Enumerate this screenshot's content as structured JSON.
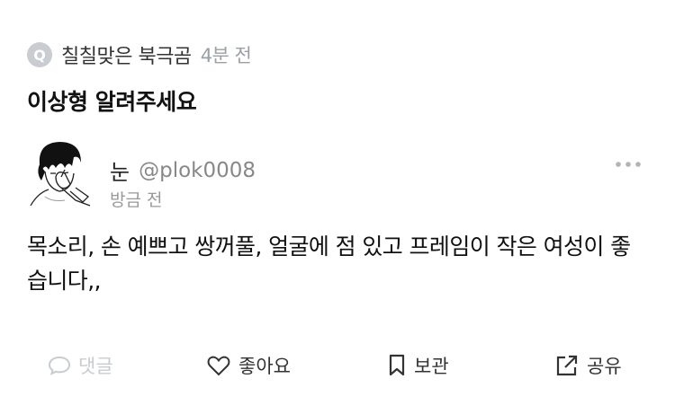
{
  "question": {
    "badge": "Q",
    "author": "칠칠맞은 북극곰",
    "time": "4분 전",
    "title": "이상형 알려주세요"
  },
  "answer": {
    "author_name": "눈",
    "author_handle": "@plok0008",
    "time": "방금 전",
    "text": "목소리, 손 예쁘고 쌍꺼풀, 얼굴에 점 있고 프레임이 작은 여성이 좋습니다,,"
  },
  "actions": {
    "comment": "댓글",
    "like": "좋아요",
    "save": "보관",
    "share": "공유"
  },
  "icons": {
    "question_badge": "q-badge-icon",
    "more": "more-dots-icon",
    "comment": "speech-bubble-icon",
    "like": "heart-icon",
    "save": "bookmark-icon",
    "share": "share-arrow-icon"
  },
  "colors": {
    "badge_bg": "#c9ccd1",
    "muted": "#9aa0a6",
    "disabled": "#c8ccd0",
    "text": "#111111"
  }
}
